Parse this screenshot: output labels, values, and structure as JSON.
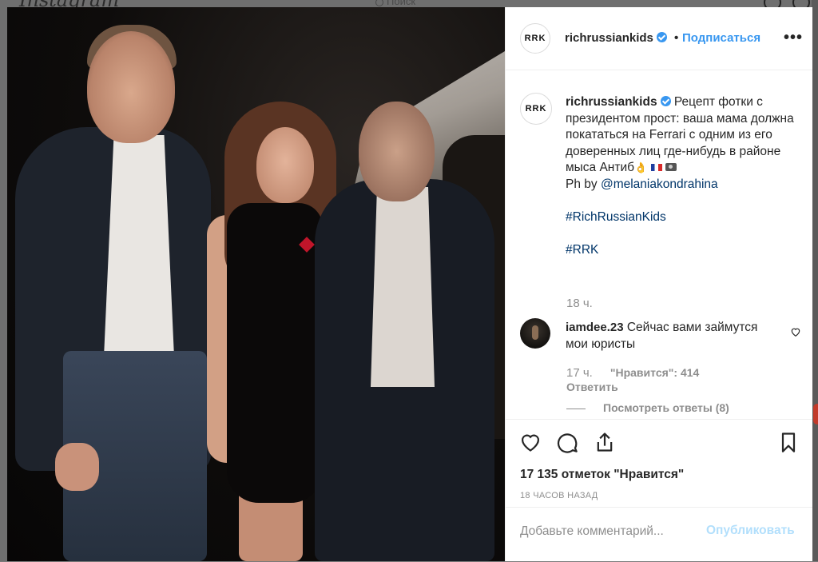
{
  "background": {
    "logo": "Instagram",
    "search_placeholder": "Поиск"
  },
  "post": {
    "header": {
      "avatar_text": "RRK",
      "username": "richrussiankids",
      "separator": "•",
      "follow_label": "Подписаться",
      "more_label": "•••"
    },
    "caption": {
      "avatar_text": "RRK",
      "username": "richrussiankids",
      "text_line1": "Рецепт фотки с президентом прост: ваша мама должна покататься на Ferrari с одним из его доверенных лиц где-нибудь в районе мыса Антиб",
      "ph_by": "Ph by ",
      "ph_link": "@melaniakondrahina",
      "hashtag1": "#RichRussianKids",
      "hashtag2": "#RRK",
      "time": "18 ч."
    },
    "comment": {
      "username": "iamdee.23",
      "text": "Сейчас вами займутся мои юристы",
      "time": "17 ч.",
      "likes": "\"Нравится\": 414",
      "reply_label": "Ответить",
      "view_replies_label": "Посмотреть ответы (8)"
    },
    "likes_text": "17 135 отметок \"Нравится\"",
    "posted_ago": "18 ЧАСОВ НАЗАД",
    "add_comment_placeholder": "Добавьте комментарий...",
    "publish_label": "Опубликовать"
  },
  "colors": {
    "accent": "#3897f0",
    "text": "#262626",
    "muted": "#8e8e8e",
    "publish_disabled": "#b2dffc"
  },
  "icons": [
    "like-heart-icon",
    "comment-icon",
    "share-icon",
    "save-bookmark-icon",
    "verified-badge-icon",
    "comment-like-heart-icon"
  ]
}
